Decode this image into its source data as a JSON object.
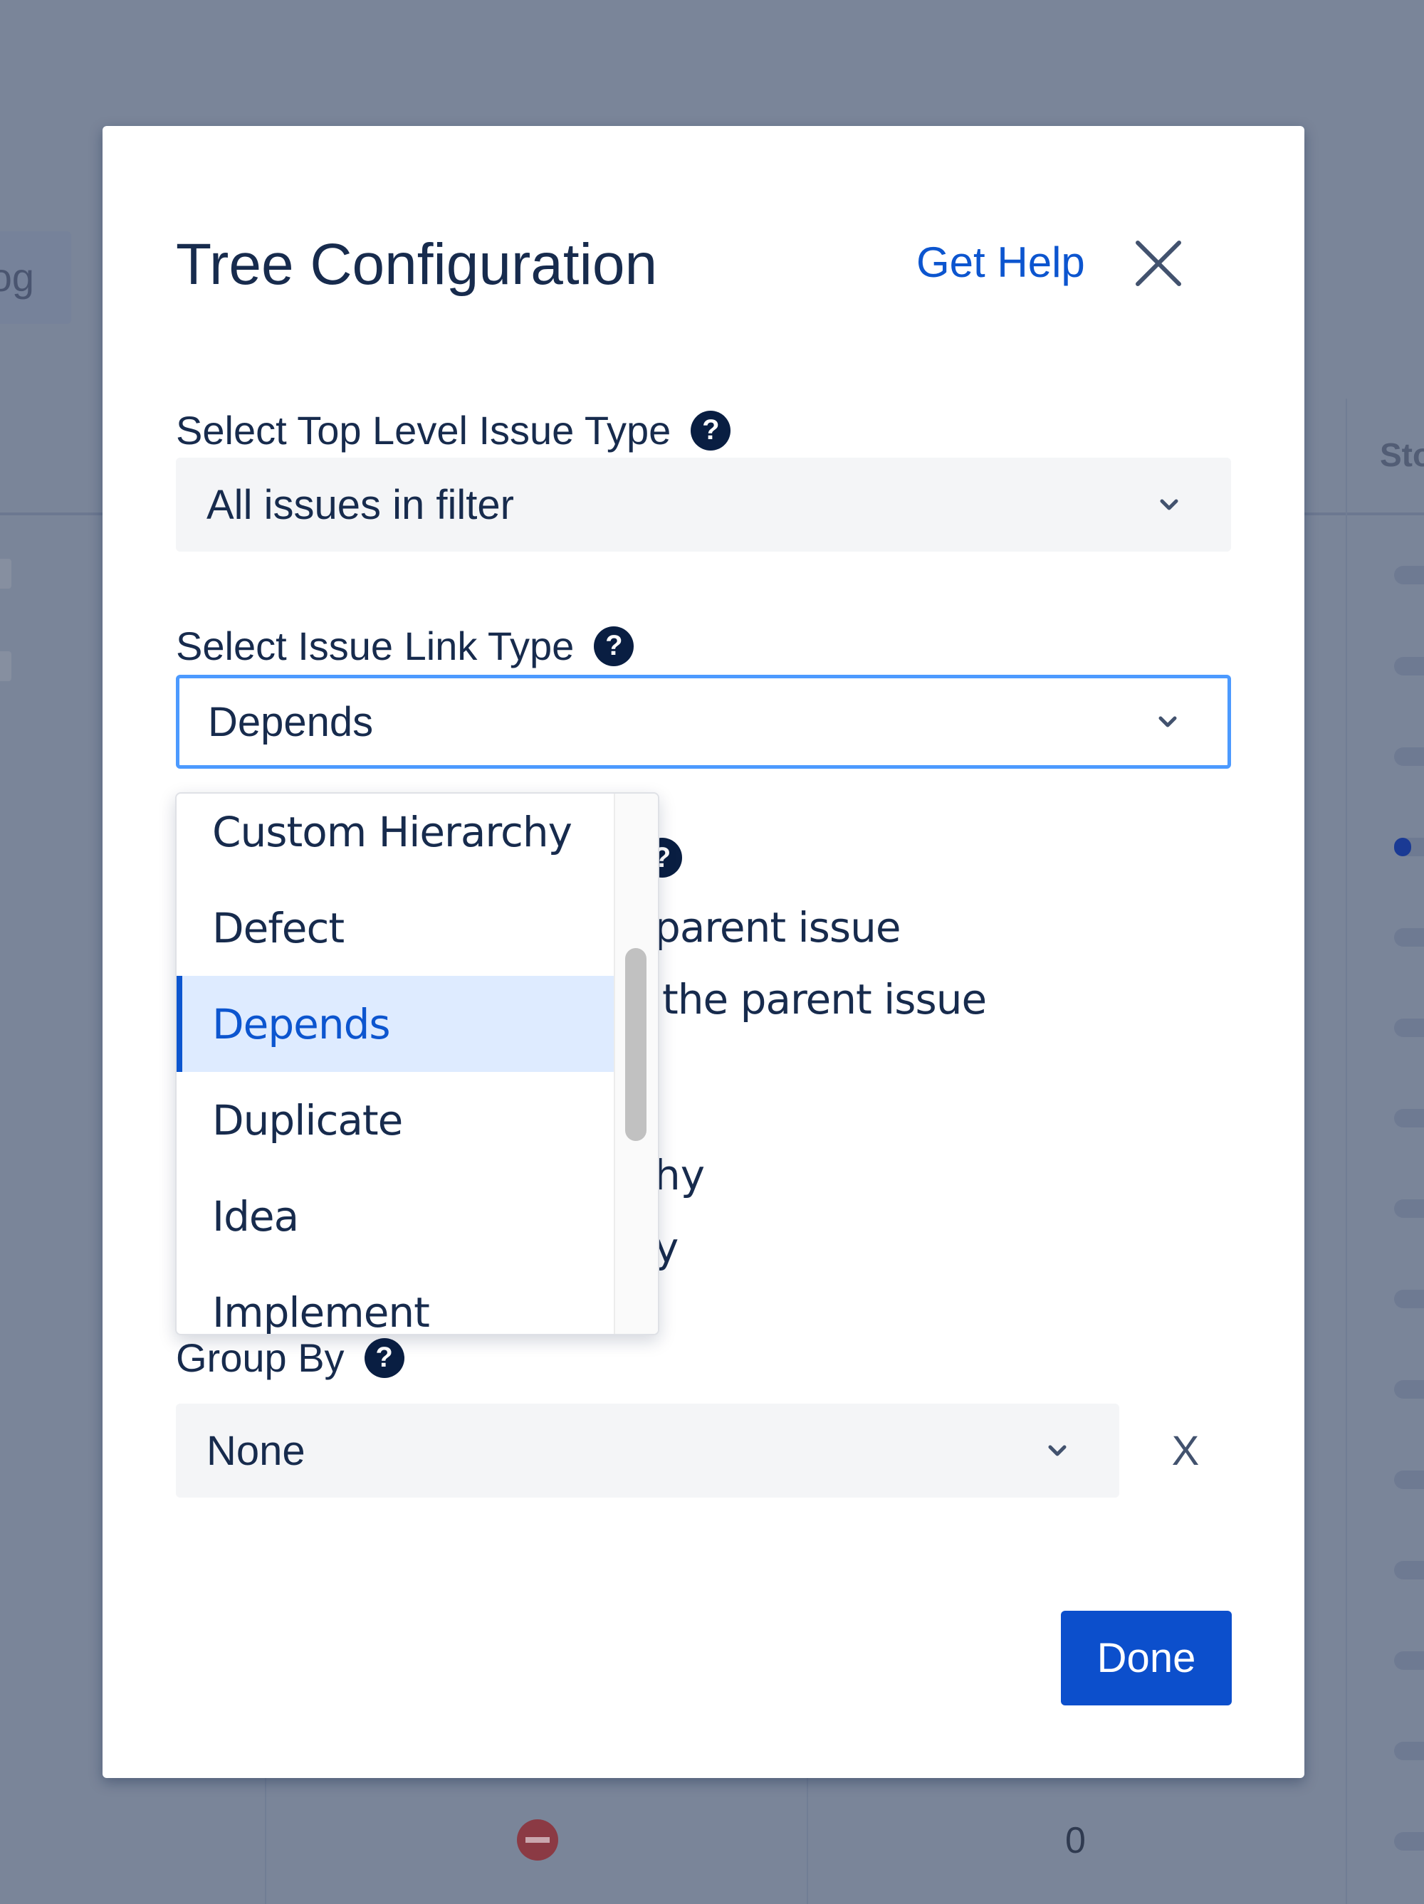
{
  "background": {
    "chip_text": "og",
    "column_header": "Sto",
    "cell_value": "0"
  },
  "modal": {
    "title": "Tree Configuration",
    "help_link": "Get Help",
    "top_level": {
      "label": "Select Top Level Issue Type",
      "value": "All issues in filter"
    },
    "link_type": {
      "label": "Select Issue Link Type",
      "value": "Depends",
      "options": [
        "Custom Hierarchy",
        "Defect",
        "Depends",
        "Duplicate",
        "Idea",
        "Implement"
      ],
      "selected_index": 2
    },
    "hidden_section": {
      "partial_lines": [
        "parent issue",
        "the parent issue",
        "hy",
        "y"
      ]
    },
    "group_by": {
      "label": "Group By",
      "value": "None",
      "clear_label": "X"
    },
    "done_label": "Done"
  },
  "colors": {
    "accent": "#0c55cf",
    "primary_button": "#0c4fcc",
    "focus_border": "#4c9aff",
    "selected_bg": "#deebff",
    "text": "#172b4d",
    "overlay": "#7a8599"
  }
}
